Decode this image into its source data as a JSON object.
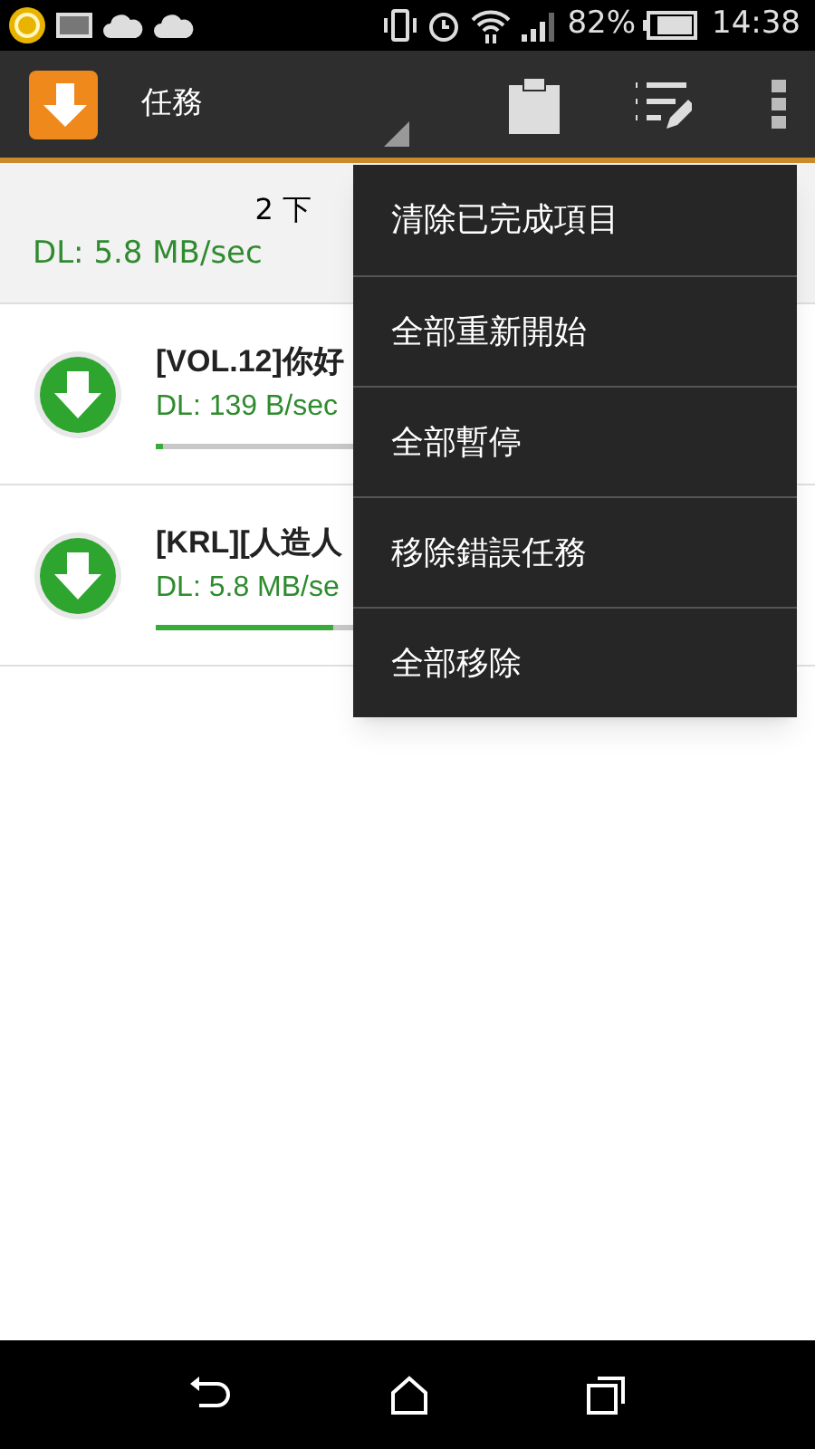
{
  "status_bar": {
    "battery": "82%",
    "time": "14:38"
  },
  "action_bar": {
    "title": "任務"
  },
  "summary": {
    "count": "2 下",
    "speed": "DL: 5.8 MB/sec"
  },
  "downloads": [
    {
      "name": "[VOL.12]你好",
      "speed": "DL: 139 B/sec",
      "level": 0.01
    },
    {
      "name": "[KRL][人造人",
      "speed": "DL: 5.8 MB/se",
      "level": 0.28
    }
  ],
  "menu": {
    "items": [
      "清除已完成項目",
      "全部重新開始",
      "全部暫停",
      "移除錯誤任務",
      "全部移除"
    ]
  }
}
